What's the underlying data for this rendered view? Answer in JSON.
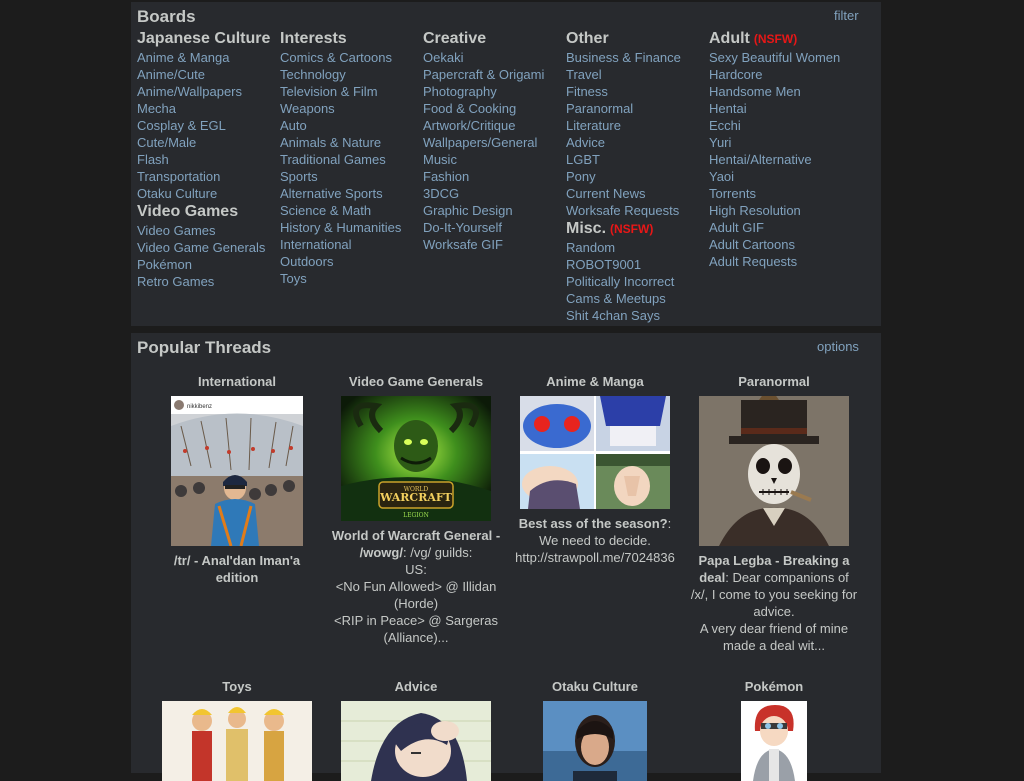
{
  "boards": {
    "title": "Boards",
    "filter_label": "filter",
    "columns": [
      {
        "groups": [
          {
            "title": "Japanese Culture",
            "nsfw": "",
            "items": [
              "Anime & Manga",
              "Anime/Cute",
              "Anime/Wallpapers",
              "Mecha",
              "Cosplay & EGL",
              "Cute/Male",
              "Flash",
              "Transportation",
              "Otaku Culture"
            ]
          },
          {
            "title": "Video Games",
            "nsfw": "",
            "items": [
              "Video Games",
              "Video Game Generals",
              "Pokémon",
              "Retro Games"
            ]
          }
        ]
      },
      {
        "groups": [
          {
            "title": "Interests",
            "nsfw": "",
            "items": [
              "Comics & Cartoons",
              "Technology",
              "Television & Film",
              "Weapons",
              "Auto",
              "Animals & Nature",
              "Traditional Games",
              "Sports",
              "Alternative Sports",
              "Science & Math",
              "History & Humanities",
              "International",
              "Outdoors",
              "Toys"
            ]
          }
        ]
      },
      {
        "groups": [
          {
            "title": "Creative",
            "nsfw": "",
            "items": [
              "Oekaki",
              "Papercraft & Origami",
              "Photography",
              "Food & Cooking",
              "Artwork/Critique",
              "Wallpapers/General",
              "Music",
              "Fashion",
              "3DCG",
              "Graphic Design",
              "Do-It-Yourself",
              "Worksafe GIF"
            ]
          }
        ]
      },
      {
        "groups": [
          {
            "title": "Other",
            "nsfw": "",
            "items": [
              "Business & Finance",
              "Travel",
              "Fitness",
              "Paranormal",
              "Literature",
              "Advice",
              "LGBT",
              "Pony",
              "Current News",
              "Worksafe Requests"
            ]
          },
          {
            "title": "Misc.",
            "nsfw": "(NSFW)",
            "items": [
              "Random",
              "ROBOT9001",
              "Politically Incorrect",
              "Cams & Meetups",
              "Shit 4chan Says"
            ]
          }
        ]
      },
      {
        "groups": [
          {
            "title": "Adult",
            "nsfw": "(NSFW)",
            "items": [
              "Sexy Beautiful Women",
              "Hardcore",
              "Handsome Men",
              "Hentai",
              "Ecchi",
              "Yuri",
              "Hentai/Alternative",
              "Yaoi",
              "Torrents",
              "High Resolution",
              "Adult GIF",
              "Adult Cartoons",
              "Adult Requests"
            ]
          }
        ]
      }
    ]
  },
  "threads": {
    "title": "Popular Threads",
    "options_label": "options",
    "items": [
      {
        "board": "International",
        "subject": "/tr/ - Anal'dan Iman'a edition",
        "lines": []
      },
      {
        "board": "Video Game Generals",
        "subject": "World of Warcraft General - /wowg/",
        "lines": [
          ": /vg/ guilds:",
          "US:",
          "<No Fun Allowed> @ Illidan (Horde)",
          "<RIP in Peace> @ Sargeras (Alliance)..."
        ]
      },
      {
        "board": "Anime & Manga",
        "subject": "Best ass of the season?",
        "lines": [
          ": We need to decide.",
          "http://strawpoll.me/7024836"
        ]
      },
      {
        "board": "Paranormal",
        "subject": "Papa Legba - Breaking a deal",
        "lines": [
          ": Dear companions of /x/, I come to you seeking for advice.",
          "A very dear friend of mine made a deal wit..."
        ]
      },
      {
        "board": "Toys",
        "subject": "",
        "lines": []
      },
      {
        "board": "Advice",
        "subject": "",
        "lines": []
      },
      {
        "board": "Otaku Culture",
        "subject": "",
        "lines": []
      },
      {
        "board": "Pokémon",
        "subject": "",
        "lines": []
      }
    ],
    "thumb_texts": {
      "insta_user": "nikkibenz",
      "wow_logo_top": "WORLD",
      "wow_logo_main": "WARCRAFT",
      "wow_logo_sub": "LEGION"
    }
  },
  "colors": {
    "page_bg": "#1c1c1c",
    "box_bg": "#282a2e",
    "text": "#c5c8c6",
    "link": "#81a2be",
    "nsfw": "#e81717"
  }
}
